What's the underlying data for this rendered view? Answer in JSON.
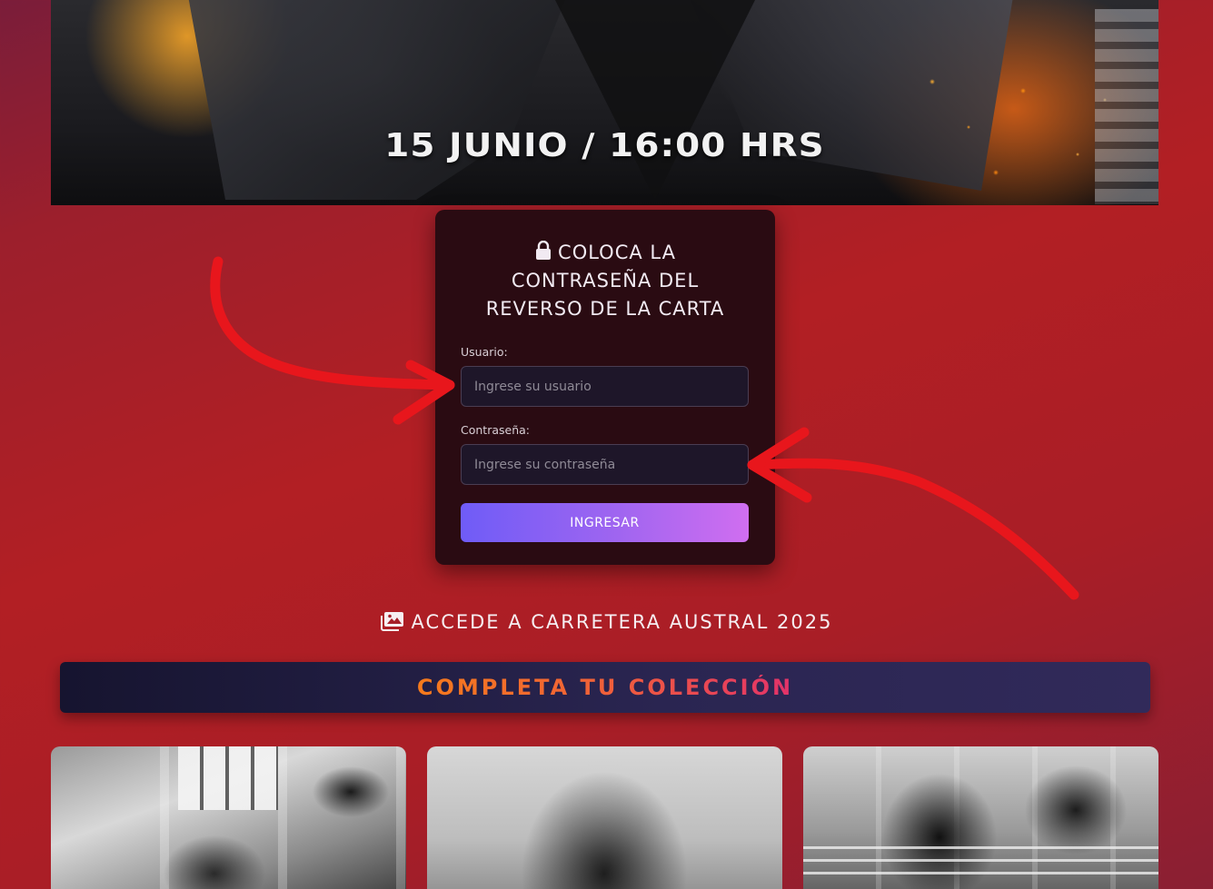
{
  "hero": {
    "date_text": "15 JUNIO / 16:00 HRS"
  },
  "login": {
    "title": "COLOCA LA CONTRASEÑA DEL REVERSO DE LA CARTA",
    "icon": "lock-icon",
    "username_label": "Usuario:",
    "username_placeholder": "Ingrese su usuario",
    "username_value": "",
    "password_label": "Contraseña:",
    "password_placeholder": "Ingrese su contraseña",
    "password_value": "",
    "submit_label": "INGRESAR"
  },
  "access": {
    "icon": "image-icon",
    "label": "ACCEDE A CARRETERA AUSTRAL 2025"
  },
  "collection": {
    "title": "COMPLETA TU COLECCIÓN"
  },
  "gallery": {
    "photos": [
      {
        "name": "photo-1"
      },
      {
        "name": "photo-2"
      },
      {
        "name": "photo-3"
      }
    ]
  },
  "colors": {
    "background": "#b21f24",
    "card": "#2a0b12",
    "button_start": "#6f5cf7",
    "button_end": "#d06ef0",
    "collection_text_start": "#f57a1c",
    "collection_text_end": "#e2326a",
    "annotation_arrow": "#e8161c"
  }
}
